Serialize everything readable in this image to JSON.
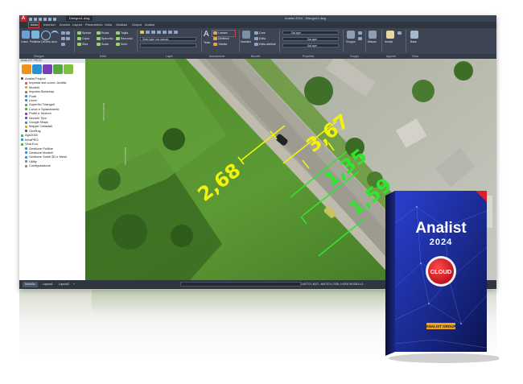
{
  "window": {
    "title": "Analist 2024 - Disegno1.dwg",
    "file_tab": "Disegno1.dwg"
  },
  "menu": {
    "tabs": [
      "Inizio",
      "Inserisci",
      "Annota",
      "Layout",
      "Parametrico",
      "Vista",
      "Gestisci",
      "Output",
      "Analist"
    ],
    "active": "Inizio"
  },
  "ribbon": {
    "draw_tools": [
      "Linea",
      "Polilinea",
      "Cerchio",
      "Arco"
    ],
    "modify_tools": [
      "Sposta",
      "Ruota",
      "Taglia",
      "Copia",
      "Specchia",
      "Raccordo",
      "Stira",
      "Scala",
      "Serie"
    ],
    "layer_field": "Stato layer non salvato",
    "annotation": {
      "text_label": "Testo",
      "quota_label": "Quota",
      "lineare": "Lineare",
      "direttrice": "Direttrice",
      "tabella": "Tabella"
    },
    "block": {
      "crea": "Crea",
      "edita": "Edita",
      "insert_label": "Inserisci",
      "attributi": "Edita attributi"
    },
    "properties": {
      "color": "DaLayer",
      "linetype": "DaLayer",
      "lineweight": "DaLayer"
    },
    "other": [
      "Gruppo",
      "Misura",
      "Incolla",
      "Base"
    ],
    "panels": [
      "Disegno",
      "Edita",
      "Layer",
      "Annotazione",
      "Blocchi",
      "Proprietà",
      "Gruppi",
      "Appunti",
      "Vista"
    ]
  },
  "panel": {
    "title": "ANALIST PROG",
    "project": "Analist Project",
    "tree": [
      "Imposta sist.coord. Analist",
      "Modelli",
      "Importa Sketchup",
      "Punti",
      "Linee",
      "Superfici Triangoli",
      "Curve e Spianamenti",
      "Profili e Sezioni",
      "Sezioni Tipo",
      "Google Maps",
      "Mappe Catastali",
      "OneRay",
      "Agri2000",
      "InfraPRO",
      "Vina Eco",
      "Gestione Poliline",
      "Gestione Modelli",
      "Gestione Solidi 3D e Mesh",
      "Utility",
      "Configurazione"
    ]
  },
  "drawing": {
    "dimensions": [
      "2,68",
      "3,67",
      "1,35",
      "1,59"
    ],
    "viewport_labels": [
      "Modello Cartella",
      "Modello Cartella"
    ]
  },
  "status": {
    "layout_tabs": [
      "Modello",
      "Layout1",
      "Layout2",
      "+"
    ],
    "command_prompt": "",
    "coordinates": "1407271.4027, 4847374.7328, 0.0000   MODELLO"
  },
  "product": {
    "brand": "Analist",
    "year": "2024",
    "badge": "CLOUD",
    "company": "ANALIST GROUP"
  },
  "colors": {
    "dimension_yellow": "#f2f20c",
    "dimension_green": "#2ee62e",
    "accent_red": "#d81f2a",
    "box_blue": "#1a2a8f"
  }
}
